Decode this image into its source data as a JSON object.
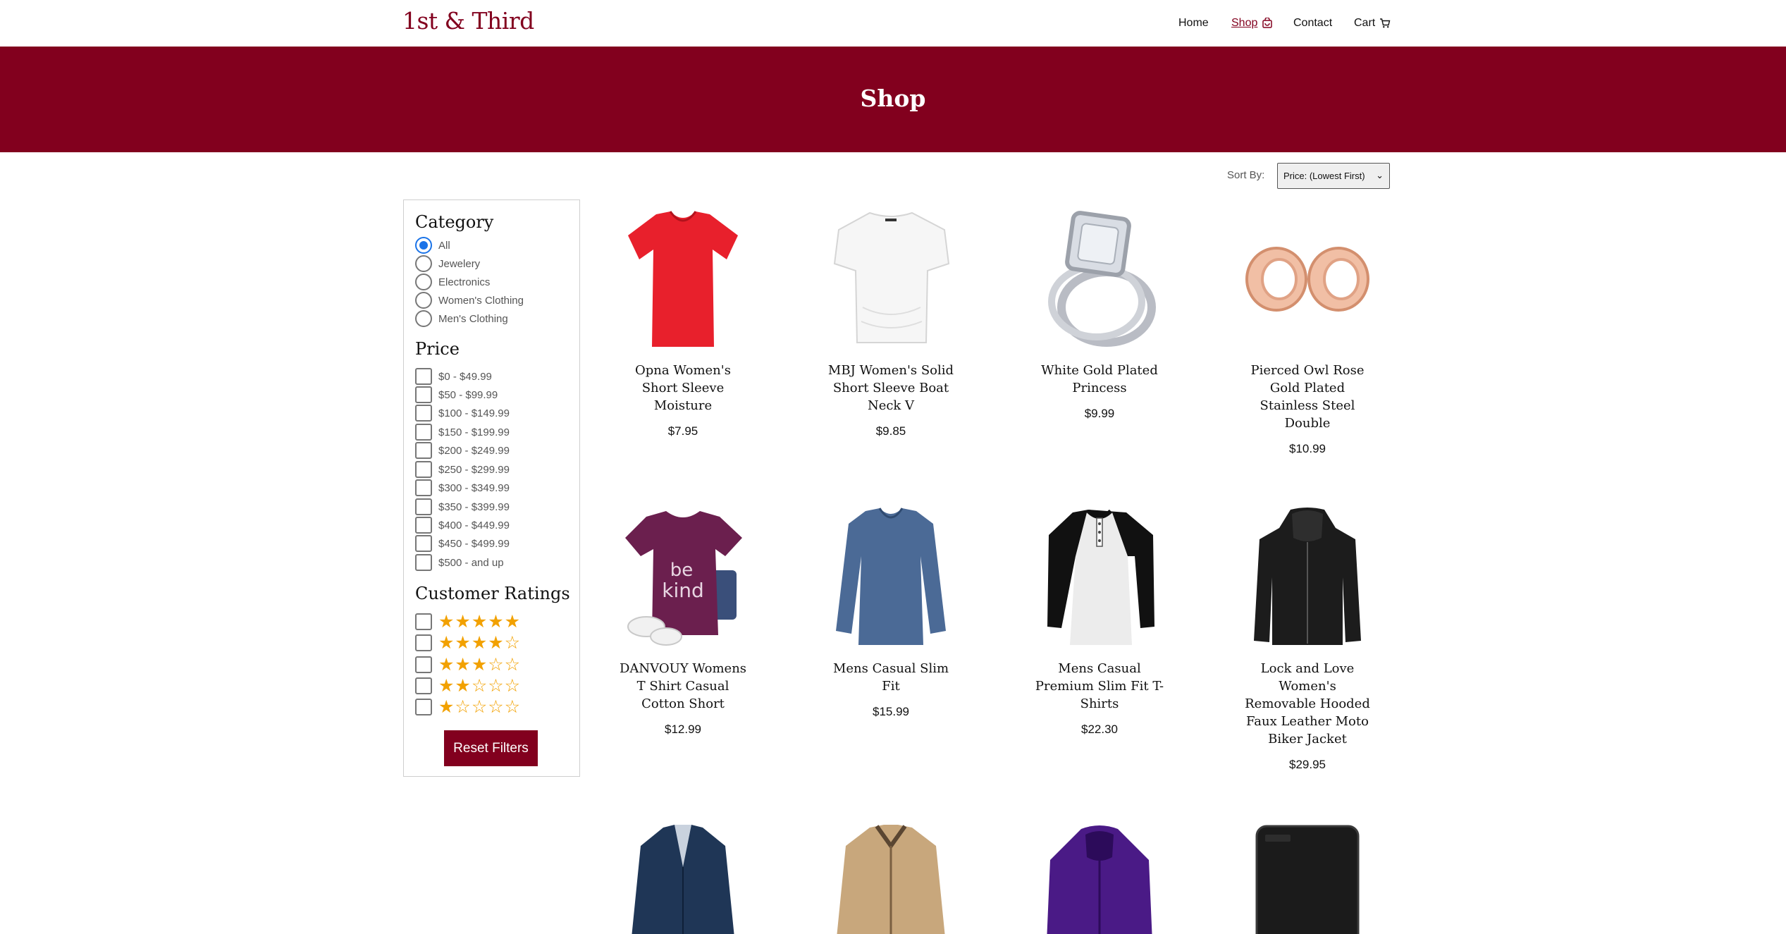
{
  "brand": "1st & Third",
  "nav": {
    "home": "Home",
    "shop": "Shop",
    "contact": "Contact",
    "cart": "Cart"
  },
  "banner_title": "Shop",
  "sort": {
    "label": "Sort By:",
    "selected": "Price: (Lowest First)"
  },
  "filters": {
    "category_heading": "Category",
    "categories": [
      "All",
      "Jewelery",
      "Electronics",
      "Women's Clothing",
      "Men's Clothing"
    ],
    "selected_category": "All",
    "price_heading": "Price",
    "prices": [
      "$0 - $49.99",
      "$50 - $99.99",
      "$100 - $149.99",
      "$150 - $199.99",
      "$200 - $249.99",
      "$250 - $299.99",
      "$300 - $349.99",
      "$350 - $399.99",
      "$400 - $449.99",
      "$450 - $499.99",
      "$500 - and up"
    ],
    "ratings_heading": "Customer Ratings",
    "ratings": [
      "★★★★★",
      "★★★★☆",
      "★★★☆☆",
      "★★☆☆☆",
      "★☆☆☆☆"
    ],
    "reset_label": "Reset Filters",
    "star_color": "#f2a100"
  },
  "products": [
    {
      "title": "Opna Women's Short Sleeve Moisture",
      "price": "$7.95",
      "image": "red-vneck-tshirt"
    },
    {
      "title": "MBJ Women's Solid Short Sleeve Boat Neck V",
      "price": "$9.85",
      "image": "white-boatneck-top"
    },
    {
      "title": "White Gold Plated Princess",
      "price": "$9.99",
      "image": "diamond-ring"
    },
    {
      "title": "Pierced Owl Rose Gold Plated Stainless Steel Double",
      "price": "$10.99",
      "image": "rose-gold-plugs"
    },
    {
      "title": "DANVOUY Womens T Shirt Casual Cotton Short",
      "price": "$12.99",
      "image": "purple-be-kind-tshirt"
    },
    {
      "title": "Mens Casual Slim Fit",
      "price": "$15.99",
      "image": "blue-longsleeve-shirt"
    },
    {
      "title": "Mens Casual Premium Slim Fit T-Shirts",
      "price": "$22.30",
      "image": "raglan-henley-shirt"
    },
    {
      "title": "Lock and Love Women's Removable Hooded Faux Leather Moto Biker Jacket",
      "price": "$29.95",
      "image": "black-leather-jacket"
    },
    {
      "title": "",
      "price": "",
      "image": "navy-trench-jacket"
    },
    {
      "title": "",
      "price": "",
      "image": "khaki-cotton-jacket"
    },
    {
      "title": "",
      "price": "",
      "image": "purple-snow-jacket"
    },
    {
      "title": "",
      "price": "",
      "image": "black-external-hard-drive"
    }
  ],
  "colors": {
    "brand": "#82001e",
    "radio_selected": "#1a73e8"
  }
}
